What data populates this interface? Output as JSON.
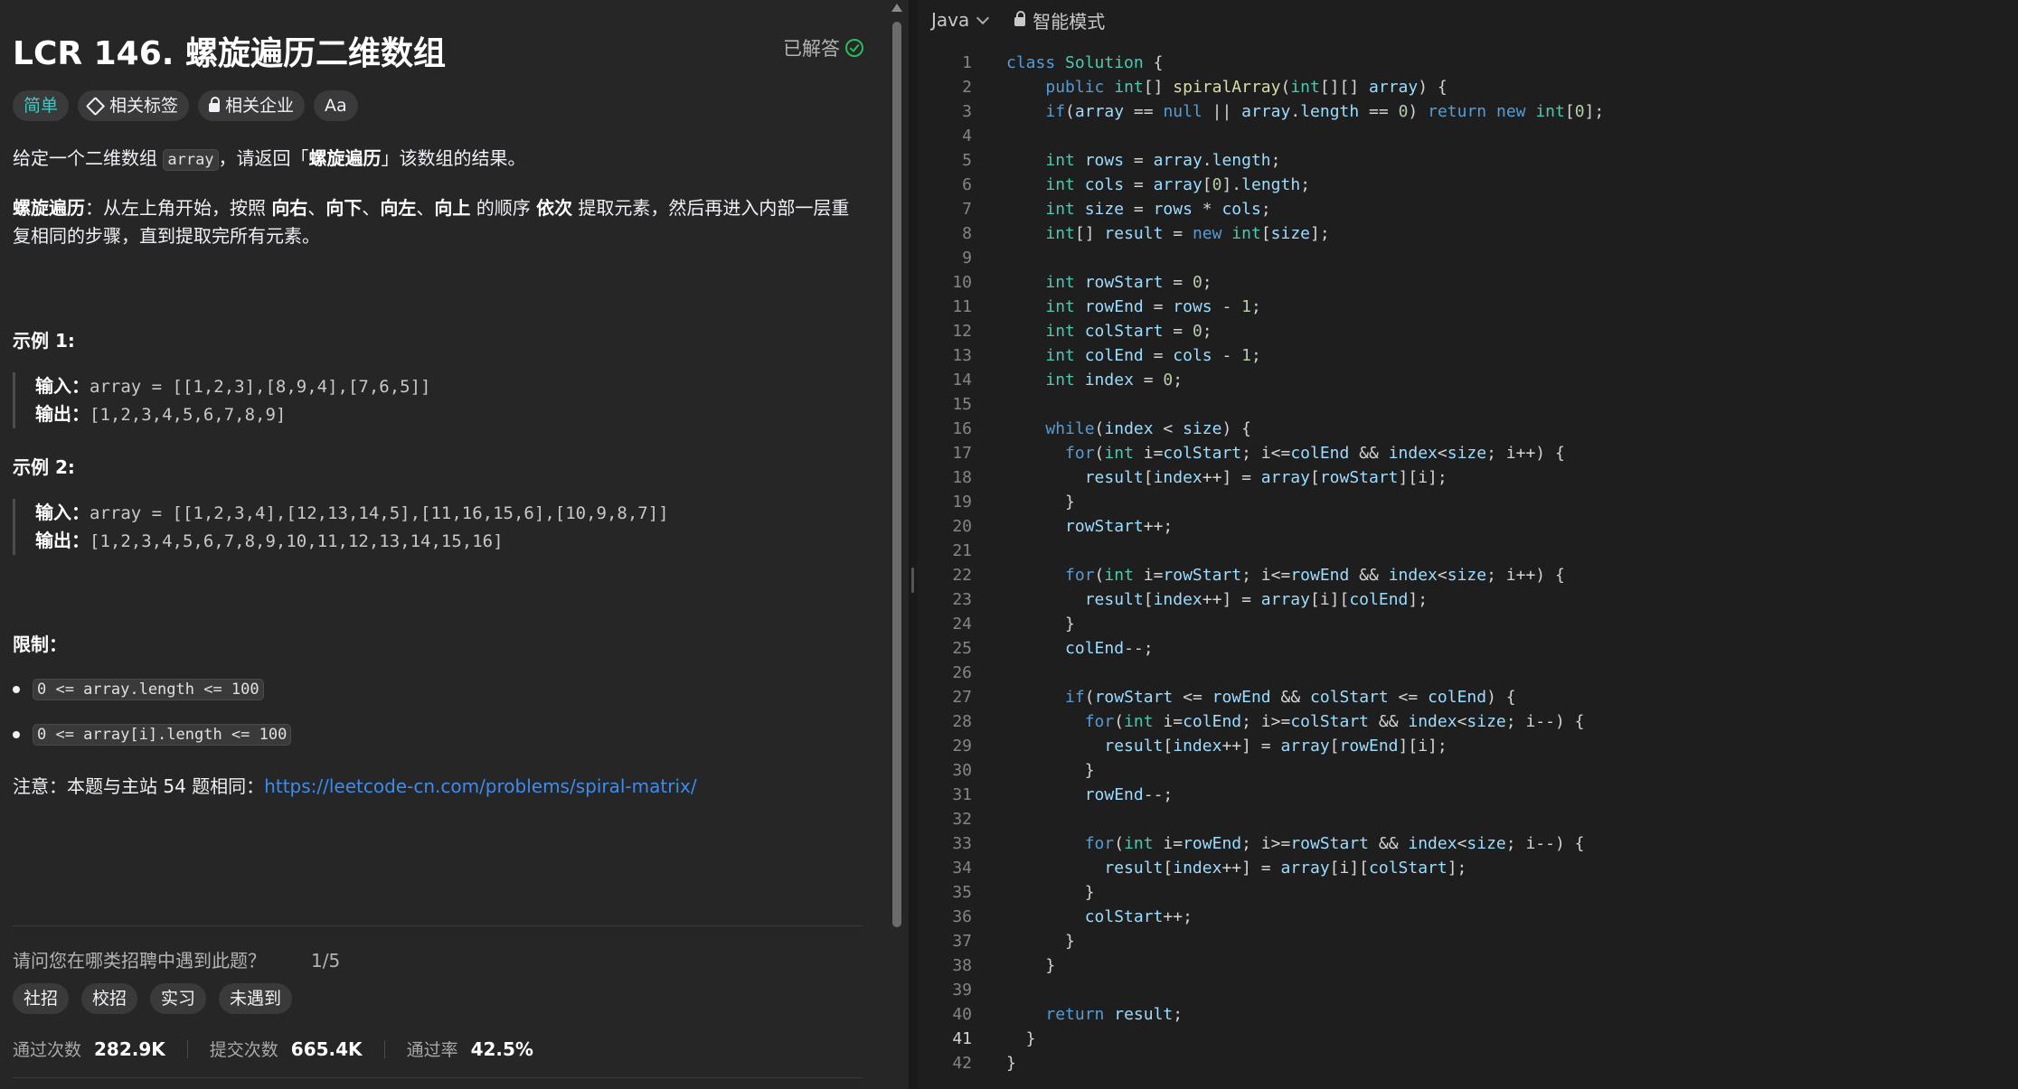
{
  "problem": {
    "title": "LCR 146. 螺旋遍历二维数组",
    "status": "已解答",
    "tags": {
      "difficulty": "简单",
      "related_tags": "相关标签",
      "related_companies": "相关企业",
      "font_toggle": "Aa"
    },
    "desc_p1": {
      "a": "给定一个二维数组 ",
      "code": "array",
      "b": "，请返回「",
      "bold": "螺旋遍历",
      "c": "」该数组的结果。"
    },
    "desc_p2": {
      "bold1": "螺旋遍历",
      "t1": "：从左上角开始，按照 ",
      "bold2": "向右",
      "t2": "、",
      "bold3": "向下",
      "t3": "、",
      "bold4": "向左",
      "t4": "、",
      "bold5": "向上",
      "t5": " 的顺序 ",
      "bold6": "依次",
      "t6": " 提取元素，然后再进入内部一层重复相同的步骤，直到提取完所有元素。"
    },
    "examples": [
      {
        "heading": "示例 1:",
        "input_label": "输入：",
        "input": "array = [[1,2,3],[8,9,4],[7,6,5]]",
        "output_label": "输出：",
        "output": "[1,2,3,4,5,6,7,8,9]"
      },
      {
        "heading": "示例 2:",
        "input_label": "输入：",
        "input": "array  = [[1,2,3,4],[12,13,14,5],[11,16,15,6],[10,9,8,7]]",
        "output_label": "输出：",
        "output": "[1,2,3,4,5,6,7,8,9,10,11,12,13,14,15,16]"
      }
    ],
    "constraints_heading": "限制：",
    "constraints": [
      "0 <= array.length <= 100",
      "0 <= array[i].length <= 100"
    ],
    "note_prefix": "注意：本题与主站 54 题相同：",
    "note_link": "https://leetcode-cn.com/problems/spiral-matrix/",
    "survey": {
      "question": "请问您在哪类招聘中遇到此题？",
      "count": "1/5",
      "options": [
        "社招",
        "校招",
        "实习",
        "未遇到"
      ]
    },
    "stats": {
      "accepted_label": "通过次数",
      "accepted": "282.9K",
      "submitted_label": "提交次数",
      "submitted": "665.4K",
      "rate_label": "通过率",
      "rate": "42.5%"
    }
  },
  "editor": {
    "language": "Java",
    "mode": "智能模式",
    "current_line": 41,
    "lines": [
      "class Solution {",
      "    public int[] spiralArray(int[][] array) {",
      "    if(array == null || array.length == 0) return new int[0];",
      "",
      "    int rows = array.length;",
      "    int cols = array[0].length;",
      "    int size = rows * cols;",
      "    int[] result = new int[size];",
      "",
      "    int rowStart = 0;",
      "    int rowEnd = rows - 1;",
      "    int colStart = 0;",
      "    int colEnd = cols - 1;",
      "    int index = 0;",
      "",
      "    while(index < size) {",
      "      for(int i=colStart; i<=colEnd && index<size; i++) {",
      "        result[index++] = array[rowStart][i];",
      "      }",
      "      rowStart++;",
      "",
      "      for(int i=rowStart; i<=rowEnd && index<size; i++) {",
      "        result[index++] = array[i][colEnd];",
      "      }",
      "      colEnd--;",
      "",
      "      if(rowStart <= rowEnd && colStart <= colEnd) {",
      "        for(int i=colEnd; i>=colStart && index<size; i--) {",
      "          result[index++] = array[rowEnd][i];",
      "        }",
      "        rowEnd--;",
      "",
      "        for(int i=rowEnd; i>=rowStart && index<size; i--) {",
      "          result[index++] = array[i][colStart];",
      "        }",
      "        colStart++;",
      "      }",
      "    }",
      "",
      "    return result;",
      "  }",
      "}"
    ]
  }
}
